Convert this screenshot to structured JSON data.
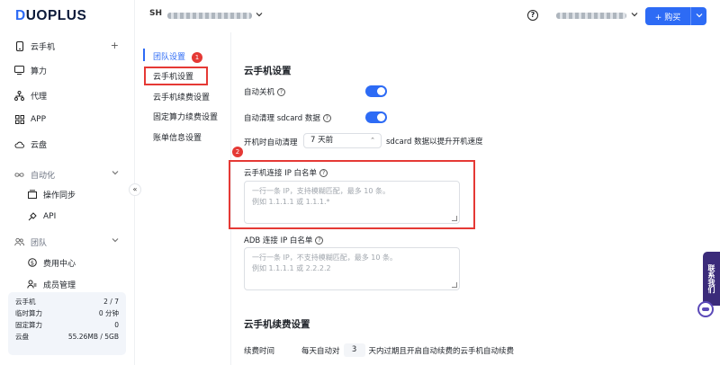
{
  "brand": {
    "logo_part1": "D",
    "logo_part2": "UOPLUS"
  },
  "sidebar": {
    "items": [
      {
        "label": "云手机",
        "icon": "phone-icon",
        "extra": "+"
      },
      {
        "label": "算力",
        "icon": "monitor-icon"
      },
      {
        "label": "代理",
        "icon": "network-icon"
      },
      {
        "label": "APP",
        "icon": "grid-icon"
      },
      {
        "label": "云盘",
        "icon": "cloud-icon"
      },
      {
        "label": "自动化",
        "icon": "infinity-icon"
      },
      {
        "label": "操作同步",
        "icon": "sync-icon"
      },
      {
        "label": "API",
        "icon": "api-icon"
      },
      {
        "label": "团队",
        "icon": "team-icon"
      },
      {
        "label": "费用中心",
        "icon": "dollar-icon"
      },
      {
        "label": "成员管理",
        "icon": "members-icon"
      }
    ],
    "stats": [
      {
        "label": "云手机",
        "value": "2 / 7"
      },
      {
        "label": "临时算力",
        "value": "0 分钟"
      },
      {
        "label": "固定算力",
        "value": "0"
      },
      {
        "label": "云盘",
        "value": "55.26MB / 5GB"
      }
    ]
  },
  "topbar": {
    "team_avatar": "SH",
    "buy_label": "+ 购买"
  },
  "subnav": {
    "items": [
      {
        "label": "团队设置"
      },
      {
        "label": "云手机设置"
      },
      {
        "label": "云手机续费设置"
      },
      {
        "label": "固定算力续费设置"
      },
      {
        "label": "账单信息设置"
      }
    ]
  },
  "settings": {
    "section_title": "云手机设置",
    "auto_shutdown_label": "自动关机",
    "auto_shutdown_on": true,
    "auto_clean_label": "自动清理 sdcard 数据",
    "auto_clean_on": true,
    "boot_clean_label": "开机时自动清理",
    "boot_clean_value": "7 天前",
    "boot_clean_suffix": "sdcard 数据以提升开机速度",
    "ip_whitelist_label": "云手机连接 IP 白名单",
    "ip_whitelist_placeholder_line1": "一行一条 IP，支持模糊匹配，最多 10 条。",
    "ip_whitelist_placeholder_line2": "例如 1.1.1.1 或 1.1.1.*",
    "adb_whitelist_label": "ADB 连接 IP 白名单",
    "adb_whitelist_placeholder_line1": "一行一条 IP，不支持模糊匹配，最多 10 条。",
    "adb_whitelist_placeholder_line2": "例如 1.1.1.1 或 2.2.2.2"
  },
  "renew": {
    "section_title": "云手机续费设置",
    "time_label": "续费时间",
    "prefix": "每天自动对",
    "days": "3",
    "suffix": "天内过期且开启自动续费的云手机自动续费"
  },
  "annotations": {
    "badge1": "1",
    "badge2": "2"
  },
  "contact": {
    "label": "联系我们"
  },
  "colors": {
    "accent": "#2d6bf5",
    "highlight": "#e53935",
    "contact": "#3b2b7a"
  }
}
